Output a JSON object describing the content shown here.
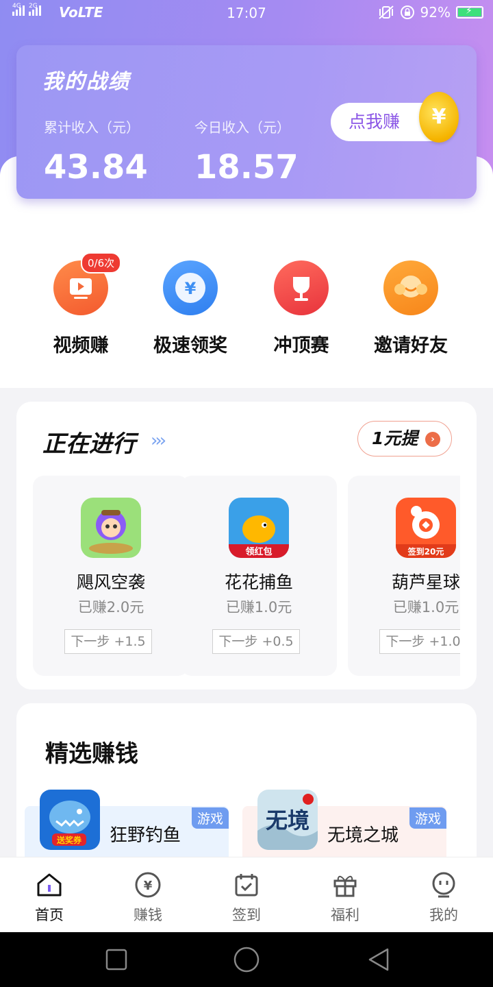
{
  "status_bar": {
    "sim1": "4G",
    "sim2": "2G",
    "volte": "VoLTE",
    "time": "17:07",
    "battery": "92%"
  },
  "stats": {
    "title": "我的战绩",
    "total_label": "累计收入（元）",
    "total_value": "43.84",
    "today_label": "今日收入（元）",
    "today_value": "18.57",
    "earn_button": "点我赚",
    "coin_symbol": "¥"
  },
  "quick_actions": [
    {
      "label": "视频赚",
      "icon": "video-icon",
      "badge": "0/6次",
      "color": "#fa6a3a"
    },
    {
      "label": "极速领奖",
      "icon": "yuan-coin-icon",
      "color": "#3d8ff3"
    },
    {
      "label": "冲顶赛",
      "icon": "trophy-icon",
      "color": "#f24a4a"
    },
    {
      "label": "邀请好友",
      "icon": "friends-icon",
      "color": "#f7941d"
    }
  ],
  "ongoing": {
    "title": "正在进行",
    "chevrons": "›››",
    "withdraw_button": "1元提",
    "tasks": [
      {
        "name": "飓风空袭",
        "earned": "已赚2.0元",
        "next": "下一步 +1.5"
      },
      {
        "name": "花花捕鱼",
        "earned": "已赚1.0元",
        "next": "下一步 +0.5",
        "icon_label": "领红包"
      },
      {
        "name": "葫芦星球",
        "earned": "已赚1.0元",
        "next": "下一步 +1.0",
        "icon_label": "签到20元"
      }
    ]
  },
  "featured": {
    "title": "精选赚钱",
    "games": [
      {
        "name": "狂野钓鱼",
        "tag": "游戏",
        "icon_label": "送奖券"
      },
      {
        "name": "无境之城",
        "tag": "游戏",
        "icon_label": "无境"
      }
    ]
  },
  "tabbar": [
    {
      "label": "首页",
      "icon": "home-icon",
      "active": true
    },
    {
      "label": "赚钱",
      "icon": "yuan-icon"
    },
    {
      "label": "签到",
      "icon": "calendar-check-icon"
    },
    {
      "label": "福利",
      "icon": "gift-icon"
    },
    {
      "label": "我的",
      "icon": "profile-icon"
    }
  ],
  "nav": [
    "recent-apps-icon",
    "home-circle-icon",
    "back-icon"
  ]
}
